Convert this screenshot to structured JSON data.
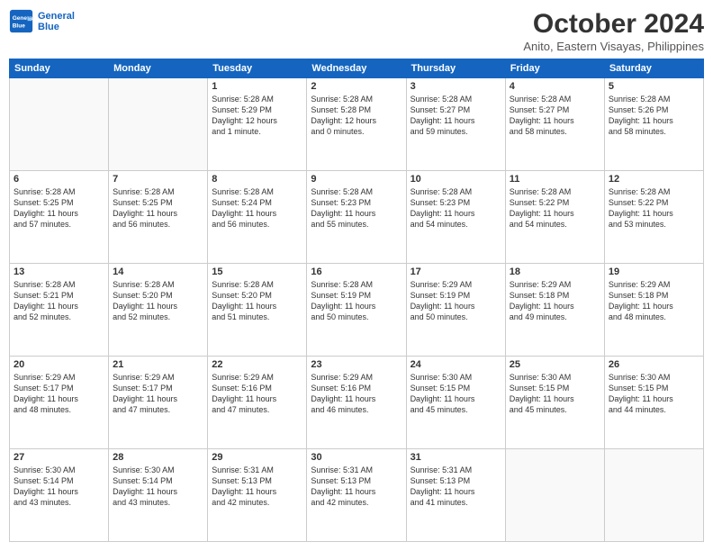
{
  "header": {
    "logo_line1": "General",
    "logo_line2": "Blue",
    "month": "October 2024",
    "location": "Anito, Eastern Visayas, Philippines"
  },
  "weekdays": [
    "Sunday",
    "Monday",
    "Tuesday",
    "Wednesday",
    "Thursday",
    "Friday",
    "Saturday"
  ],
  "weeks": [
    [
      {
        "day": "",
        "info": ""
      },
      {
        "day": "",
        "info": ""
      },
      {
        "day": "1",
        "info": "Sunrise: 5:28 AM\nSunset: 5:29 PM\nDaylight: 12 hours\nand 1 minute."
      },
      {
        "day": "2",
        "info": "Sunrise: 5:28 AM\nSunset: 5:28 PM\nDaylight: 12 hours\nand 0 minutes."
      },
      {
        "day": "3",
        "info": "Sunrise: 5:28 AM\nSunset: 5:27 PM\nDaylight: 11 hours\nand 59 minutes."
      },
      {
        "day": "4",
        "info": "Sunrise: 5:28 AM\nSunset: 5:27 PM\nDaylight: 11 hours\nand 58 minutes."
      },
      {
        "day": "5",
        "info": "Sunrise: 5:28 AM\nSunset: 5:26 PM\nDaylight: 11 hours\nand 58 minutes."
      }
    ],
    [
      {
        "day": "6",
        "info": "Sunrise: 5:28 AM\nSunset: 5:25 PM\nDaylight: 11 hours\nand 57 minutes."
      },
      {
        "day": "7",
        "info": "Sunrise: 5:28 AM\nSunset: 5:25 PM\nDaylight: 11 hours\nand 56 minutes."
      },
      {
        "day": "8",
        "info": "Sunrise: 5:28 AM\nSunset: 5:24 PM\nDaylight: 11 hours\nand 56 minutes."
      },
      {
        "day": "9",
        "info": "Sunrise: 5:28 AM\nSunset: 5:23 PM\nDaylight: 11 hours\nand 55 minutes."
      },
      {
        "day": "10",
        "info": "Sunrise: 5:28 AM\nSunset: 5:23 PM\nDaylight: 11 hours\nand 54 minutes."
      },
      {
        "day": "11",
        "info": "Sunrise: 5:28 AM\nSunset: 5:22 PM\nDaylight: 11 hours\nand 54 minutes."
      },
      {
        "day": "12",
        "info": "Sunrise: 5:28 AM\nSunset: 5:22 PM\nDaylight: 11 hours\nand 53 minutes."
      }
    ],
    [
      {
        "day": "13",
        "info": "Sunrise: 5:28 AM\nSunset: 5:21 PM\nDaylight: 11 hours\nand 52 minutes."
      },
      {
        "day": "14",
        "info": "Sunrise: 5:28 AM\nSunset: 5:20 PM\nDaylight: 11 hours\nand 52 minutes."
      },
      {
        "day": "15",
        "info": "Sunrise: 5:28 AM\nSunset: 5:20 PM\nDaylight: 11 hours\nand 51 minutes."
      },
      {
        "day": "16",
        "info": "Sunrise: 5:28 AM\nSunset: 5:19 PM\nDaylight: 11 hours\nand 50 minutes."
      },
      {
        "day": "17",
        "info": "Sunrise: 5:29 AM\nSunset: 5:19 PM\nDaylight: 11 hours\nand 50 minutes."
      },
      {
        "day": "18",
        "info": "Sunrise: 5:29 AM\nSunset: 5:18 PM\nDaylight: 11 hours\nand 49 minutes."
      },
      {
        "day": "19",
        "info": "Sunrise: 5:29 AM\nSunset: 5:18 PM\nDaylight: 11 hours\nand 48 minutes."
      }
    ],
    [
      {
        "day": "20",
        "info": "Sunrise: 5:29 AM\nSunset: 5:17 PM\nDaylight: 11 hours\nand 48 minutes."
      },
      {
        "day": "21",
        "info": "Sunrise: 5:29 AM\nSunset: 5:17 PM\nDaylight: 11 hours\nand 47 minutes."
      },
      {
        "day": "22",
        "info": "Sunrise: 5:29 AM\nSunset: 5:16 PM\nDaylight: 11 hours\nand 47 minutes."
      },
      {
        "day": "23",
        "info": "Sunrise: 5:29 AM\nSunset: 5:16 PM\nDaylight: 11 hours\nand 46 minutes."
      },
      {
        "day": "24",
        "info": "Sunrise: 5:30 AM\nSunset: 5:15 PM\nDaylight: 11 hours\nand 45 minutes."
      },
      {
        "day": "25",
        "info": "Sunrise: 5:30 AM\nSunset: 5:15 PM\nDaylight: 11 hours\nand 45 minutes."
      },
      {
        "day": "26",
        "info": "Sunrise: 5:30 AM\nSunset: 5:15 PM\nDaylight: 11 hours\nand 44 minutes."
      }
    ],
    [
      {
        "day": "27",
        "info": "Sunrise: 5:30 AM\nSunset: 5:14 PM\nDaylight: 11 hours\nand 43 minutes."
      },
      {
        "day": "28",
        "info": "Sunrise: 5:30 AM\nSunset: 5:14 PM\nDaylight: 11 hours\nand 43 minutes."
      },
      {
        "day": "29",
        "info": "Sunrise: 5:31 AM\nSunset: 5:13 PM\nDaylight: 11 hours\nand 42 minutes."
      },
      {
        "day": "30",
        "info": "Sunrise: 5:31 AM\nSunset: 5:13 PM\nDaylight: 11 hours\nand 42 minutes."
      },
      {
        "day": "31",
        "info": "Sunrise: 5:31 AM\nSunset: 5:13 PM\nDaylight: 11 hours\nand 41 minutes."
      },
      {
        "day": "",
        "info": ""
      },
      {
        "day": "",
        "info": ""
      }
    ]
  ]
}
